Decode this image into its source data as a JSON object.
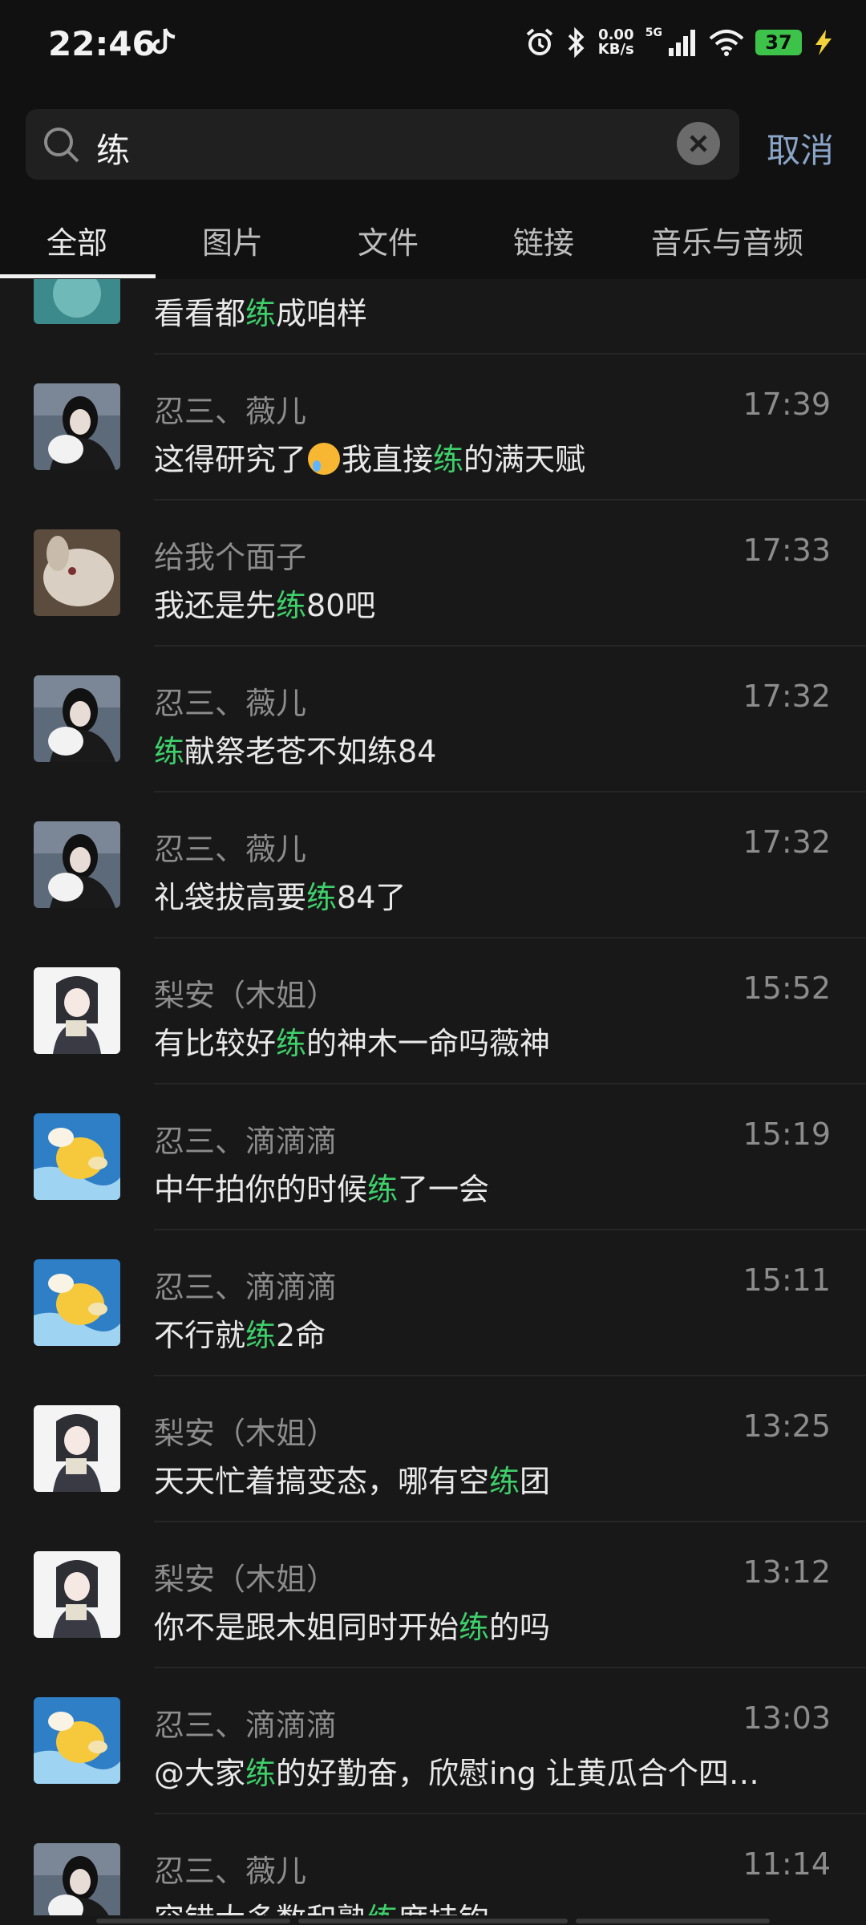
{
  "status_bar": {
    "time": "22:46",
    "net_speed_value": "0.00",
    "net_speed_unit": "KB/s",
    "network_type": "5G",
    "battery": "37",
    "icons": [
      "tiktok-icon",
      "alarm-icon",
      "bluetooth-icon",
      "signal-icon",
      "wifi-icon",
      "battery-icon",
      "charging-icon"
    ]
  },
  "search": {
    "query": "练",
    "cancel_label": "取消"
  },
  "tabs": [
    {
      "label": "全部",
      "active": true
    },
    {
      "label": "图片",
      "active": false
    },
    {
      "label": "文件",
      "active": false
    },
    {
      "label": "链接",
      "active": false
    },
    {
      "label": "音乐与音频",
      "active": false
    }
  ],
  "results": [
    {
      "name": "",
      "time": "",
      "pre": "看看都",
      "hit": "练",
      "post": "成咱样",
      "avatar": "cyan"
    },
    {
      "name": "忍三、薇儿",
      "time": "17:39",
      "pre": "这得研究了",
      "emoji": true,
      "pre2": "我直接",
      "hit": "练",
      "post": "的满天赋",
      "avatar": "girl"
    },
    {
      "name": "给我个面子",
      "time": "17:33",
      "pre": "我还是先",
      "hit": "练",
      "post": "80吧",
      "avatar": "rabbit"
    },
    {
      "name": "忍三、薇儿",
      "time": "17:32",
      "pre": "",
      "hit": "练",
      "post": "献祭老苍不如练84",
      "avatar": "girl"
    },
    {
      "name": "忍三、薇儿",
      "time": "17:32",
      "pre": "礼袋拔高要",
      "hit": "练",
      "post": "84了",
      "avatar": "girl"
    },
    {
      "name": "梨安（木姐）",
      "time": "15:52",
      "pre": "有比较好",
      "hit": "练",
      "post": "的神木一命吗薇神",
      "avatar": "anime"
    },
    {
      "name": "忍三、滴滴滴",
      "time": "15:19",
      "pre": "中午拍你的时候",
      "hit": "练",
      "post": "了一会",
      "avatar": "duck"
    },
    {
      "name": "忍三、滴滴滴",
      "time": "15:11",
      "pre": "不行就",
      "hit": "练",
      "post": "2命",
      "avatar": "duck"
    },
    {
      "name": "梨安（木姐）",
      "time": "13:25",
      "pre": "天天忙着搞变态，哪有空",
      "hit": "练",
      "post": "团",
      "avatar": "anime"
    },
    {
      "name": "梨安（木姐）",
      "time": "13:12",
      "pre": "你不是跟木姐同时开始",
      "hit": "练",
      "post": "的吗",
      "avatar": "anime"
    },
    {
      "name": "忍三、滴滴滴",
      "time": "13:03",
      "pre": "@大家",
      "hit": "练",
      "post": "的好勤奋，欣慰ing 让黄瓜合个四…",
      "avatar": "duck"
    },
    {
      "name": "忍三、薇儿",
      "time": "11:14",
      "pre": "容错大多数和熟",
      "hit": "练",
      "post": "度挂钩",
      "avatar": "girl"
    }
  ],
  "colors": {
    "background": "#181818",
    "header": "#111111",
    "highlight": "#3fcf6b",
    "cancel": "#8aa4c7"
  }
}
